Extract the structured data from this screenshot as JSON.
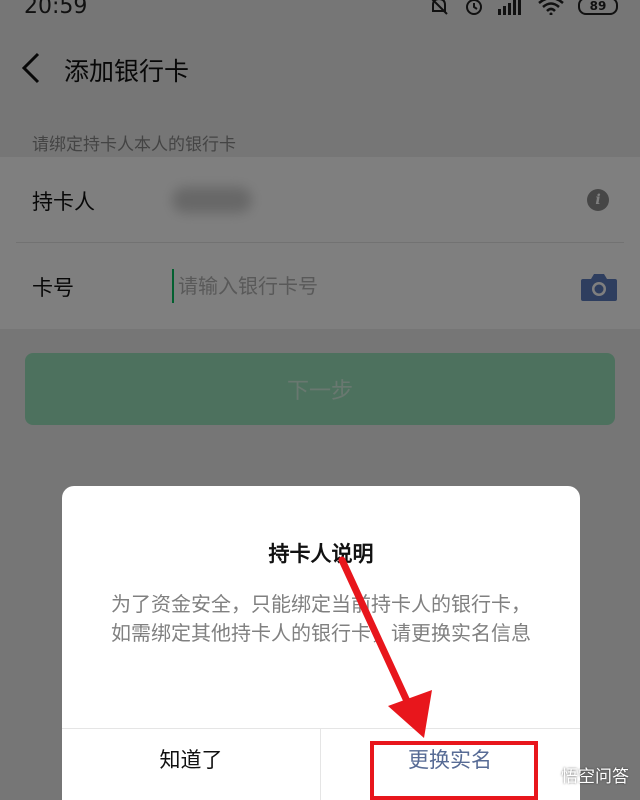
{
  "status": {
    "time": "20:59",
    "battery": "89"
  },
  "nav": {
    "title": "添加银行卡"
  },
  "form": {
    "hint": "请绑定持卡人本人的银行卡",
    "holder_label": "持卡人",
    "card_label": "卡号",
    "card_placeholder": "请输入银行卡号",
    "card_value": ""
  },
  "next_button": {
    "label": "下一步"
  },
  "dialog": {
    "title": "持卡人说明",
    "body": "为了资金安全，只能绑定当前持卡人的银行卡，如需绑定其他持卡人的银行卡，请更换实名信息",
    "ok_label": "知道了",
    "change_label": "更换实名"
  },
  "watermark": {
    "text": "悟空问答"
  },
  "colors": {
    "brand_green": "#07c160",
    "link_blue": "#576b95",
    "annotation_red": "#e8161c"
  },
  "icons": [
    "back-chevron-icon",
    "info-icon",
    "camera-icon",
    "mute-icon",
    "alarm-icon",
    "signal-icon",
    "wifi-icon",
    "battery-icon"
  ]
}
